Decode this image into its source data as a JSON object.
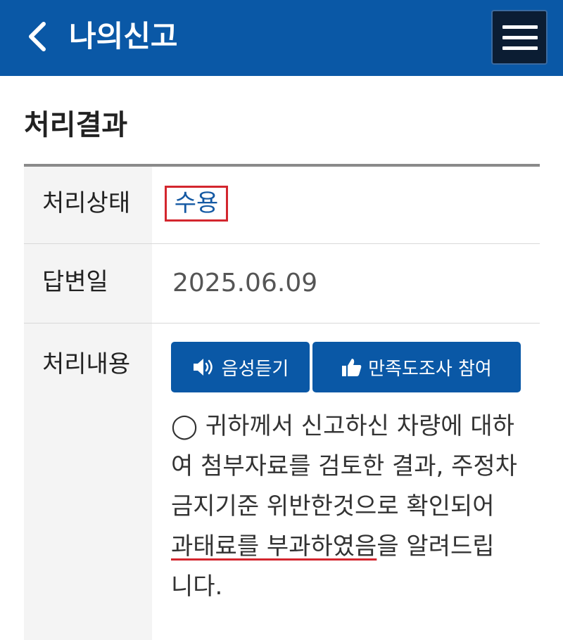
{
  "header": {
    "title": "나의신고",
    "back_icon": "chevron-left-icon",
    "menu_icon": "hamburger-menu-icon",
    "bar_color": "#0a58a6"
  },
  "section": {
    "title": "처리결과"
  },
  "table": {
    "status": {
      "label": "처리상태",
      "value": "수용",
      "highlight_color": "#d3262e"
    },
    "answer_date": {
      "label": "답변일",
      "value": "2025.06.09"
    },
    "content": {
      "label": "처리내용",
      "listen_button": {
        "label": "음성듣기",
        "icon": "speaker-icon"
      },
      "survey_button": {
        "label": "만족도조사 참여",
        "icon": "thumbs-up-icon"
      },
      "lines": [
        "◯ 귀하께서 신고하신 차량에 대하",
        "여 첨부자료를 검토한 결과, 주정차",
        "금지기준 위반한것으로 확인되어"
      ],
      "line4_underlined": "과태료를 부과하였음",
      "line4_rest": "을 알려드립",
      "line5": "니다."
    }
  }
}
